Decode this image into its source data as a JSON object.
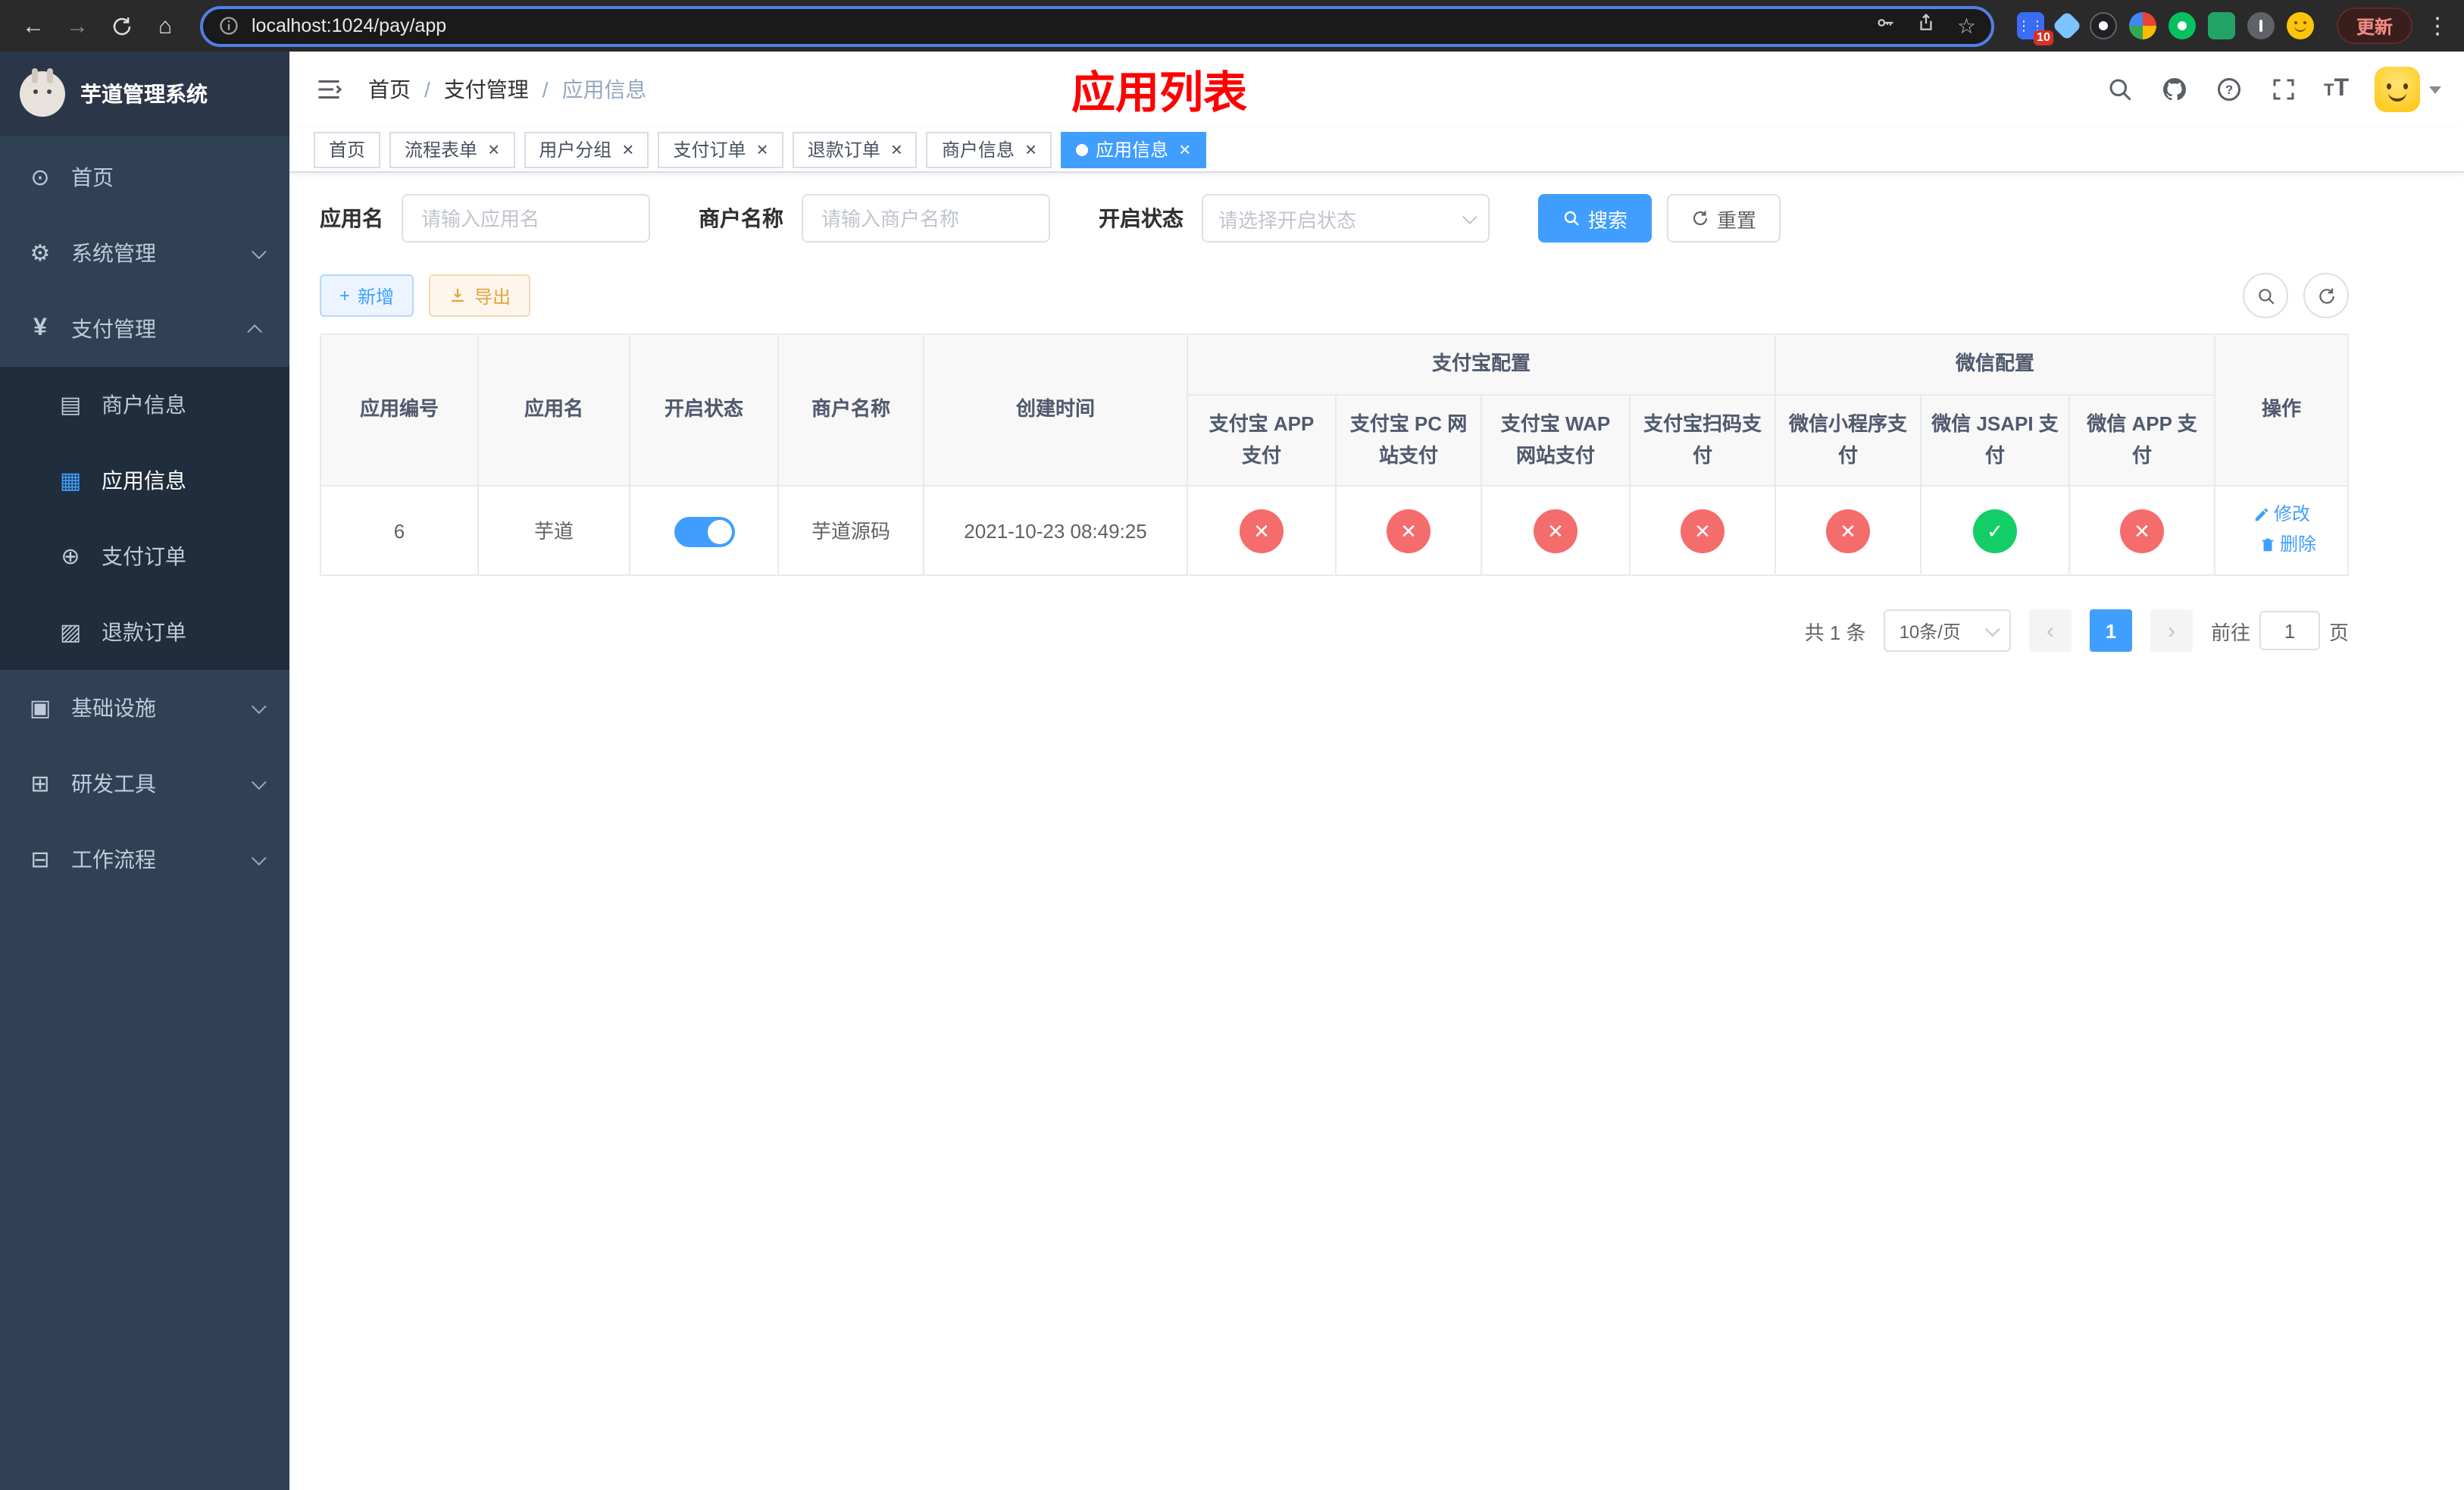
{
  "colors": {
    "accent": "#409eff",
    "danger": "#f56c6c",
    "success": "#13ce66",
    "title_red": "#ff0000"
  },
  "browser": {
    "url": "localhost:1024/pay/app",
    "update_label": "更新",
    "extension_badge": "10"
  },
  "sidebar": {
    "logo_title": "芋道管理系统",
    "items": [
      {
        "label": "首页"
      },
      {
        "label": "系统管理"
      },
      {
        "label": "支付管理"
      },
      {
        "label": "基础设施"
      },
      {
        "label": "研发工具"
      },
      {
        "label": "工作流程"
      }
    ],
    "pay_children": [
      {
        "label": "商户信息"
      },
      {
        "label": "应用信息"
      },
      {
        "label": "支付订单"
      },
      {
        "label": "退款订单"
      }
    ]
  },
  "header": {
    "breadcrumb": [
      "首页",
      "支付管理",
      "应用信息"
    ],
    "page_title": "应用列表"
  },
  "tabs": [
    {
      "label": "首页"
    },
    {
      "label": "流程表单"
    },
    {
      "label": "用户分组"
    },
    {
      "label": "支付订单"
    },
    {
      "label": "退款订单"
    },
    {
      "label": "商户信息"
    },
    {
      "label": "应用信息"
    }
  ],
  "filters": {
    "app_name_label": "应用名",
    "app_name_placeholder": "请输入应用名",
    "merchant_label": "商户名称",
    "merchant_placeholder": "请输入商户名称",
    "status_label": "开启状态",
    "status_placeholder": "请选择开启状态",
    "search_label": "搜索",
    "reset_label": "重置"
  },
  "toolbar": {
    "add_label": "新增",
    "export_label": "导出"
  },
  "table": {
    "headers": {
      "app_id": "应用编号",
      "app_name": "应用名",
      "status": "开启状态",
      "merchant": "商户名称",
      "created": "创建时间",
      "alipay_group": "支付宝配置",
      "wechat_group": "微信配置",
      "actions": "操作",
      "alipay_app": "支付宝 APP 支付",
      "alipay_pc": "支付宝 PC 网站支付",
      "alipay_wap": "支付宝 WAP 网站支付",
      "alipay_qr": "支付宝扫码支付",
      "wx_mini": "微信小程序支付",
      "wx_jsapi": "微信 JSAPI 支付",
      "wx_app": "微信 APP 支付"
    },
    "row": {
      "app_id": "6",
      "app_name": "芋道",
      "status_enabled": true,
      "merchant": "芋道源码",
      "created": "2021-10-23 08:49:25",
      "configs": {
        "alipay_app": false,
        "alipay_pc": false,
        "alipay_wap": false,
        "alipay_qr": false,
        "wx_mini": false,
        "wx_jsapi": true,
        "wx_app": false
      },
      "edit_label": "修改",
      "delete_label": "删除"
    }
  },
  "pagination": {
    "total": "共 1 条",
    "page_size": "10条/页",
    "page": "1",
    "goto_prefix": "前往",
    "goto_value": "1",
    "goto_suffix": "页"
  }
}
